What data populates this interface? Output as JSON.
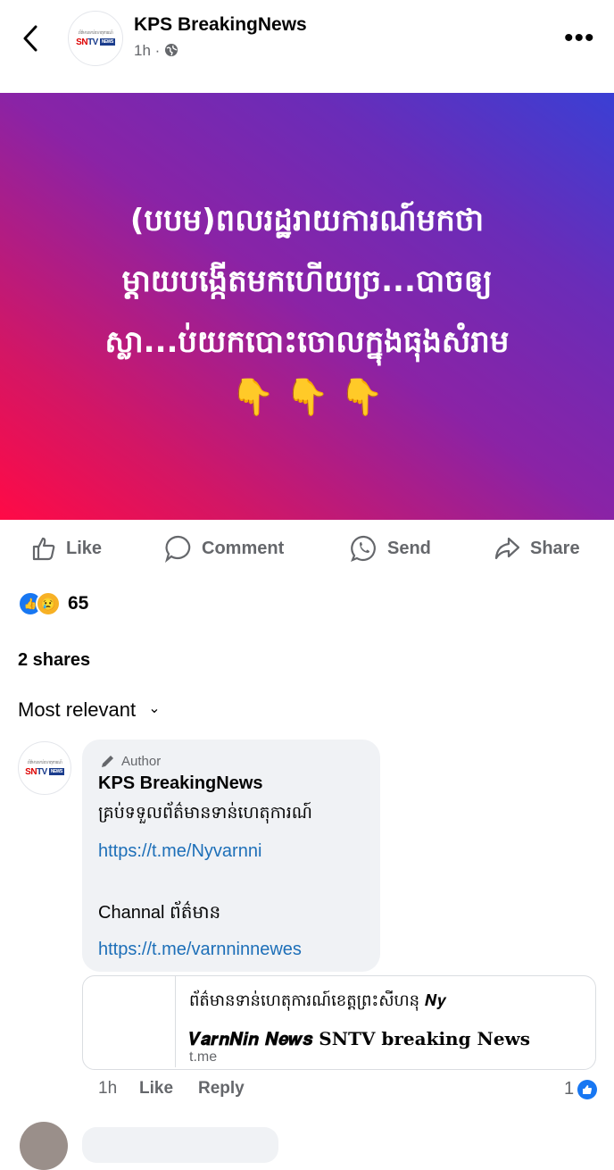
{
  "header": {
    "page_name": "KPS BreakingNews",
    "time": "1h",
    "privacy_sep": "·"
  },
  "logo": {
    "tagline": "ព័ត៌មានទាន់ហេតុការណ៍",
    "sn": "SN",
    "tv": "TV",
    "news": "NEWS"
  },
  "post": {
    "lines": [
      "(បបម)ពលរដ្ឋរាយការណ៍មកថា",
      "ម្ដាយបង្កើតមកហើយច្រ...បាចឲ្យ",
      "ស្លា...ប់យកបោះចោលក្នុងធុងសំរាម"
    ],
    "emoji": "👇 👇 👇",
    "gradient_colors": [
      "#ff0a46",
      "#8a23a6",
      "#3a3fd4"
    ]
  },
  "actions": {
    "like": "Like",
    "comment": "Comment",
    "send": "Send",
    "share": "Share"
  },
  "reactions": {
    "like_icon": "👍",
    "sad_icon": "😢",
    "count": "65"
  },
  "shares": "2 shares",
  "sort": {
    "label": "Most relevant",
    "chevron": "⌄"
  },
  "comment": {
    "badge": "Author",
    "name": "KPS BreakingNews",
    "line1": "គ្រប់ទទួលព័ត៌មានទាន់ហេតុការណ៍",
    "link1": "https://t.me/Nyvarnni",
    "line2": "Channal ព័ត៌មាន",
    "link2": "https://t.me/varnninnewes",
    "preview": {
      "title_line1": "ព័ត៌មានទាន់ហេតុការណ៍ខេត្តព្រះសីហនុ 𝑵𝒚",
      "title_line2": "𝑽𝒂𝒓𝒏𝑵𝒊𝒏 𝑵𝒆𝒘𝒔 SNTV breaking News",
      "domain": "t.me"
    },
    "time": "1h",
    "like": "Like",
    "reply": "Reply",
    "like_count": "1"
  },
  "colors": {
    "link": "#1d6fb8",
    "like_blue": "#1877f2",
    "muted": "#65676b"
  }
}
